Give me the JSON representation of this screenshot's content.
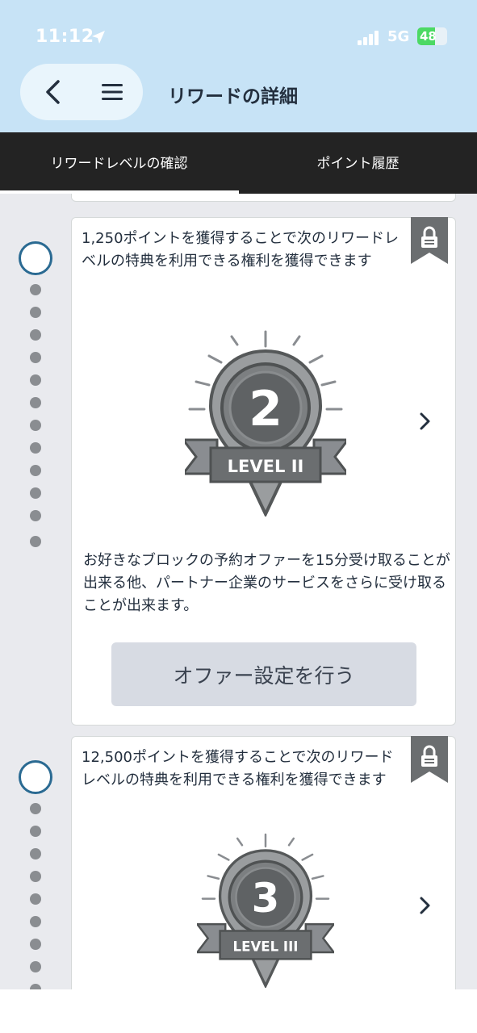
{
  "status_bar": {
    "time": "11:12",
    "network": "5G",
    "battery": "48"
  },
  "header": {
    "title": "リワードの詳細",
    "background_color": "#c7e3f6"
  },
  "tabs": [
    {
      "label": "リワードレベルの確認",
      "selected": true
    },
    {
      "label": "ポイント履歴",
      "selected": false
    }
  ],
  "levels": [
    {
      "requirement": "1,250ポイントを獲得することで次のリワードレベルの特典を利用できる権利を獲得できます",
      "badge_number": "2",
      "badge_label": "LEVEL II",
      "benefit": "お好きなブロックの予約オファーを15分受け取ることが出来る他、パートナー企業のサービスをさらに受け取ることが出来ます。",
      "button_label": "オファー設定を行う",
      "locked": true
    },
    {
      "requirement": "12,500ポイントを獲得することで次のリワードレベルの特典を利用できる権利を獲得できます",
      "badge_number": "3",
      "badge_label": "LEVEL III",
      "locked": true
    }
  ],
  "icons": {
    "back": "chevron-left",
    "menu": "hamburger",
    "lock": "lock",
    "next": "chevron-right",
    "location": "location-arrow",
    "signal": "cellular-signal"
  },
  "colors": {
    "timeline_accent": "#2a6a92",
    "badge_gray": "#6b6e70",
    "tab_bar": "#232323"
  }
}
